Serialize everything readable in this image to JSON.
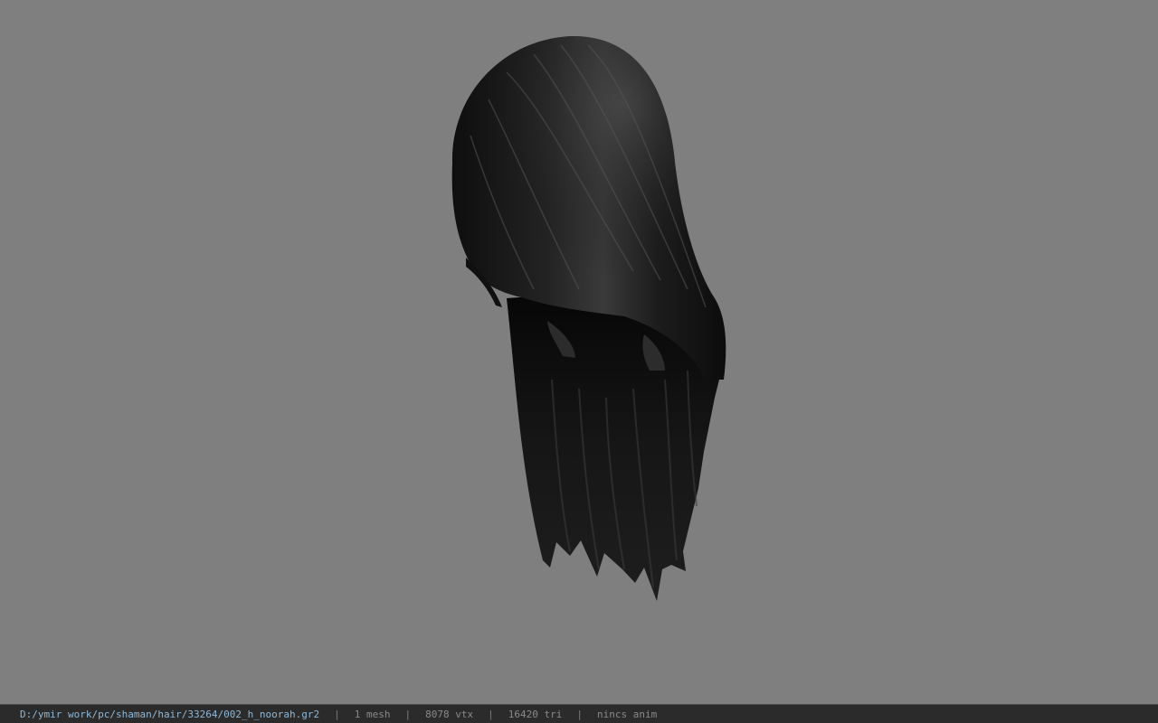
{
  "viewer": {
    "file_path": "D:/ymir work/pc/shaman/hair/33264/002_h_noorah.gr2",
    "stats": {
      "mesh": "1 mesh",
      "vertices": "8078 vtx",
      "triangles": "16420 tri",
      "anim": "nincs anim"
    },
    "separator": "|"
  },
  "colors": {
    "viewport_bg": "#7f7f7f",
    "statusbar_bg": "#2b2b2b",
    "path_text": "#8fb8d8",
    "stat_text": "#8a8a8a",
    "hair_base": "#141414",
    "hair_highlight": "#5a5a5a"
  }
}
